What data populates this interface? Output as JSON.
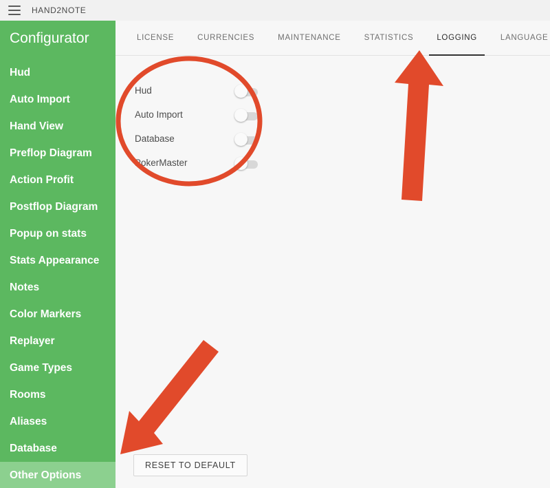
{
  "window": {
    "title": "HAND2NOTE",
    "menu_icon": "hamburger-icon"
  },
  "sidebar": {
    "title": "Configurator",
    "items": [
      {
        "label": "Hud",
        "active": false
      },
      {
        "label": "Auto Import",
        "active": false
      },
      {
        "label": "Hand View",
        "active": false
      },
      {
        "label": "Preflop Diagram",
        "active": false
      },
      {
        "label": "Action Profit",
        "active": false
      },
      {
        "label": "Postflop Diagram",
        "active": false
      },
      {
        "label": "Popup on stats",
        "active": false
      },
      {
        "label": "Stats Appearance",
        "active": false
      },
      {
        "label": "Notes",
        "active": false
      },
      {
        "label": "Color Markers",
        "active": false
      },
      {
        "label": "Replayer",
        "active": false
      },
      {
        "label": "Game Types",
        "active": false
      },
      {
        "label": "Rooms",
        "active": false
      },
      {
        "label": "Aliases",
        "active": false
      },
      {
        "label": "Database",
        "active": false
      },
      {
        "label": "Other Options",
        "active": true
      }
    ]
  },
  "tabs": [
    {
      "label": "LICENSE",
      "active": false
    },
    {
      "label": "CURRENCIES",
      "active": false
    },
    {
      "label": "MAINTENANCE",
      "active": false
    },
    {
      "label": "STATISTICS",
      "active": false
    },
    {
      "label": "LOGGING",
      "active": true
    },
    {
      "label": "LANGUAGE",
      "active": false
    }
  ],
  "logging_panel": {
    "toggles": [
      {
        "label": "Hud",
        "on": false
      },
      {
        "label": "Auto Import",
        "on": false
      },
      {
        "label": "Database",
        "on": false
      },
      {
        "label": "PokerMaster",
        "on": false
      }
    ],
    "reset_button": "RESET TO DEFAULT"
  },
  "annotations": {
    "color": "#e14a2b",
    "ellipse_highlight": "toggle-list",
    "arrow_to_logging_tab": "LOGGING",
    "arrow_to_reset_button": "RESET TO DEFAULT"
  }
}
